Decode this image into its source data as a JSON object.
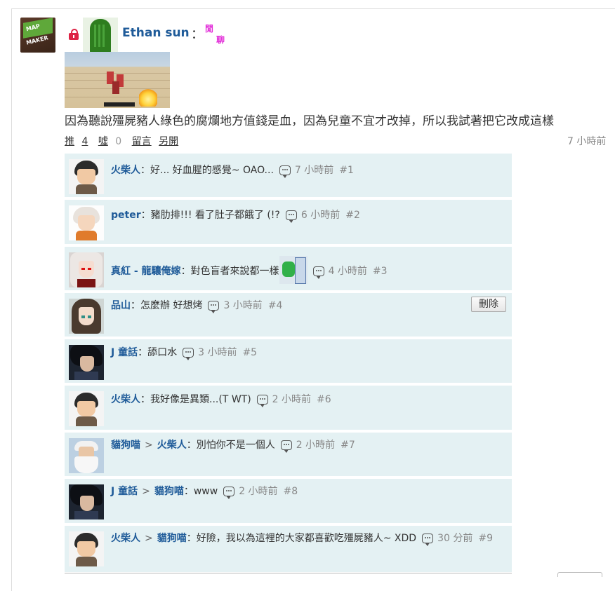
{
  "post": {
    "author": "Ethan sun",
    "colon": "：",
    "mood_chars": [
      "閒",
      "聊"
    ],
    "text": "因為聽說殭屍豬人綠色的腐爛地方值錢是血，因為兒童不宜才改掉，所以我試著把它改成這樣",
    "time": "7 小時前",
    "actions": {
      "push_label": "推",
      "push_count": "4",
      "boo_label": "噓",
      "boo_count": "0",
      "comment_label": "留言",
      "open_label": "另開"
    }
  },
  "comments": [
    {
      "user": "火柴人",
      "reply_to": "",
      "text": "：好... 好血腥的感覺~ OAO...",
      "time": "7 小時前",
      "num": "#1",
      "avatar": "boy"
    },
    {
      "user": "peter",
      "reply_to": "",
      "text": "：豬肋排!!! 看了肚子都餓了 (!?",
      "time": "6 小時前",
      "num": "#2",
      "avatar": "white"
    },
    {
      "user": "真紅 - 龍驤俺嫁",
      "reply_to": "",
      "text": "：對色盲者來說都一樣",
      "time": "4 小時前",
      "num": "#3",
      "avatar": "red"
    },
    {
      "user": "品山",
      "reply_to": "",
      "text": "：怎麼辦 好想烤",
      "time": "3 小時前",
      "num": "#4",
      "avatar": "girl",
      "delete_label": "刪除"
    },
    {
      "user": "J 童話",
      "reply_to": "",
      "text": "：舔口水",
      "time": "3 小時前",
      "num": "#5",
      "avatar": "dark"
    },
    {
      "user": "火柴人",
      "reply_to": "",
      "text": "：我好像是異類...(T WT)",
      "time": "2 小時前",
      "num": "#6",
      "avatar": "boy"
    },
    {
      "user": "貓狗喵",
      "reply_to": "火柴人",
      "text": "：別怕你不是一個人",
      "time": "2 小時前",
      "num": "#7",
      "avatar": "old"
    },
    {
      "user": "J 童話",
      "reply_to": "貓狗喵",
      "text": "：www",
      "time": "2 小時前",
      "num": "#8",
      "avatar": "dark"
    },
    {
      "user": "火柴人",
      "reply_to": "貓狗喵",
      "text": "：好險，我以為這裡的大家都喜歡吃殭屍豬人~ XDD",
      "time": "30 分前",
      "num": "#9",
      "avatar": "boy"
    }
  ],
  "post_avatar_text": [
    "MAP",
    "MAKER"
  ],
  "reply_sep": ">"
}
